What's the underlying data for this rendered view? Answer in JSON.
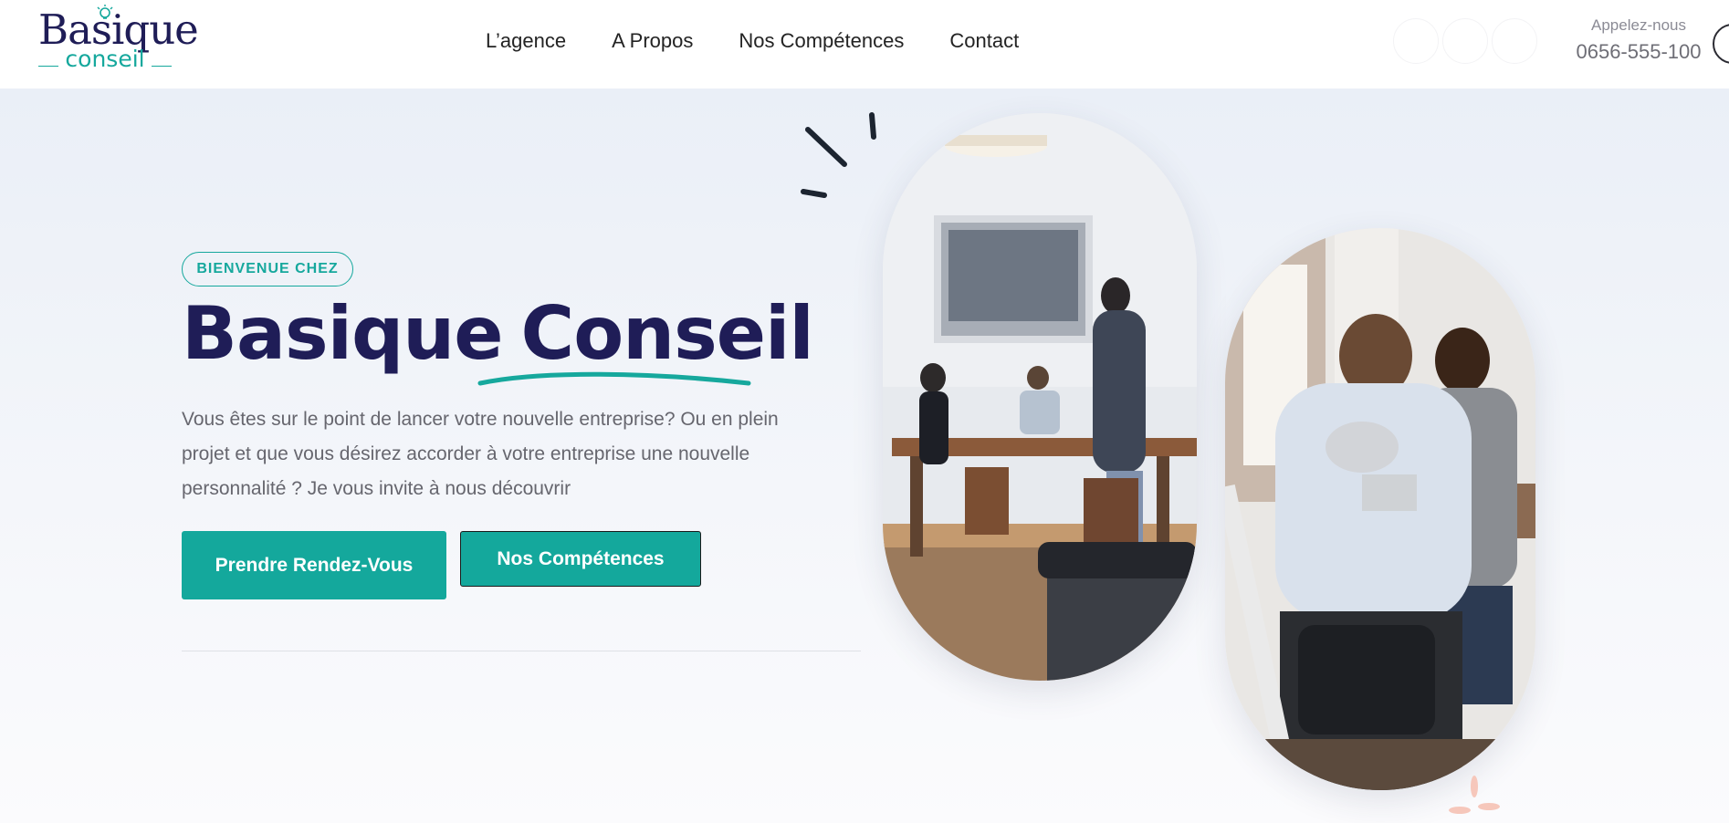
{
  "header": {
    "logo": {
      "main": "Basique",
      "sub": "conseil"
    },
    "nav": [
      {
        "label": "L’agence"
      },
      {
        "label": "A Propos"
      },
      {
        "label": "Nos Compétences"
      },
      {
        "label": "Contact"
      }
    ],
    "call": {
      "label": "Appelez-nous",
      "phone": "0656-555-100"
    }
  },
  "hero": {
    "badge": "BIENVENUE CHEZ",
    "title_part1": "Basique",
    "title_part2": "Conseil",
    "description": "Vous êtes sur le point de lancer votre nouvelle entreprise? Ou en plein projet et que vous désirez accorder à votre entreprise une nouvelle personnalité ? Je vous invite à nous découvrir",
    "primary_button": "Prendre Rendez-Vous",
    "secondary_button": "Nos Compétences"
  },
  "colors": {
    "navy": "#1f1d57",
    "teal": "#16a89d",
    "text_gray": "#66666e",
    "spark": "#1c2430",
    "flower": "#f6c7bb"
  }
}
